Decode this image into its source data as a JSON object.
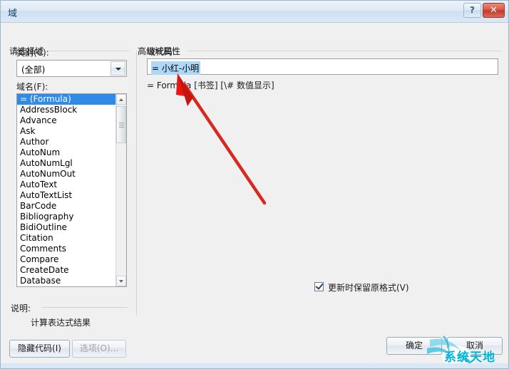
{
  "window": {
    "title": "域",
    "help_button": "?",
    "close_button": "✕"
  },
  "left_panel": {
    "section_title": "请选择域",
    "category_label": "类别(C):",
    "category_value": "(全部)",
    "fieldname_label": "域名(F):",
    "field_names": [
      "= (Formula)",
      "AddressBlock",
      "Advance",
      "Ask",
      "Author",
      "AutoNum",
      "AutoNumLgl",
      "AutoNumOut",
      "AutoText",
      "AutoTextList",
      "BarCode",
      "Bibliography",
      "BidiOutline",
      "Citation",
      "Comments",
      "Compare",
      "CreateDate",
      "Database"
    ],
    "selected_field": "= (Formula)",
    "description_label": "说明:",
    "description_text": "计算表达式结果",
    "hide_code_button": "隐藏代码(I)",
    "options_button": "选项(O)..."
  },
  "right_panel": {
    "section_title": "高级域属性",
    "fieldcode_label": "域代码:",
    "fieldcode_value": "= 小红-小明",
    "syntax_hint": "= Formula [书签] [\\# 数值显示]",
    "preserve_format_label": "更新时保留原格式(V)",
    "preserve_format_checked": true
  },
  "footer": {
    "ok_button": "确定",
    "cancel_button": "取消"
  },
  "watermark": {
    "text": "系统天地"
  },
  "colors": {
    "selection_blue": "#2f8ae8",
    "text_highlight": "#add8f7",
    "annotation_red": "#e02020",
    "watermark_cyan": "#00b4d8",
    "close_red": "#c3392b"
  }
}
